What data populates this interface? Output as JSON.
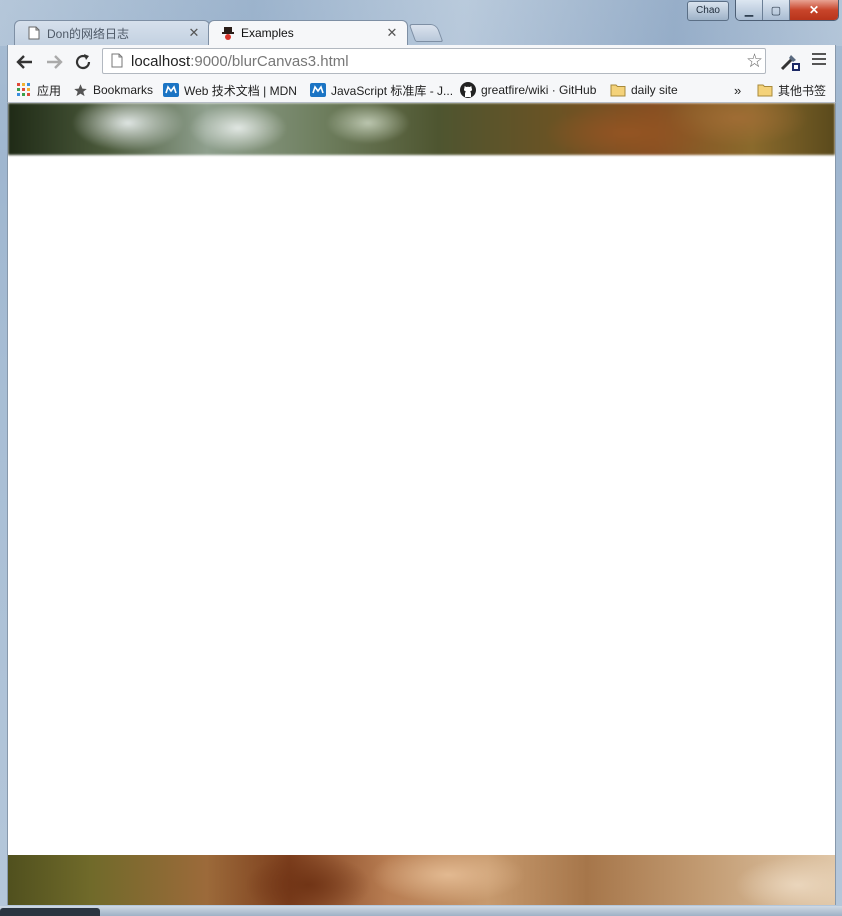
{
  "window": {
    "user_badge": "Chao",
    "min_symbol": "▁",
    "max_symbol": "▢",
    "close_symbol": "✕"
  },
  "tabs": [
    {
      "title": "Don的网络日志",
      "state": "inactive",
      "close": "✕"
    },
    {
      "title": "Examples",
      "state": "active",
      "close": "✕"
    }
  ],
  "address_bar": {
    "host": "localhost",
    "rest": ":9000/blurCanvas3.html",
    "star_icon": "☆"
  },
  "bookmarks": {
    "items": [
      {
        "label": "应用",
        "icon": "apps-grid-icon"
      },
      {
        "label": "Bookmarks",
        "icon": "star-icon"
      },
      {
        "label": "Web 技术文档 | MDN",
        "icon": "mdn-icon"
      },
      {
        "label": "JavaScript 标准库 - J...",
        "icon": "mdn-icon"
      },
      {
        "label": "greatfire/wiki · GitHub",
        "icon": "github-icon"
      },
      {
        "label": "daily site",
        "icon": "folder-icon"
      }
    ],
    "overflow": "»",
    "other": {
      "label": "其他书签",
      "icon": "folder-icon"
    }
  },
  "colors": {
    "accent_close": "#c8452b",
    "frame": "#a8bdd3",
    "tab_active_bg": "#f6f7f9"
  }
}
